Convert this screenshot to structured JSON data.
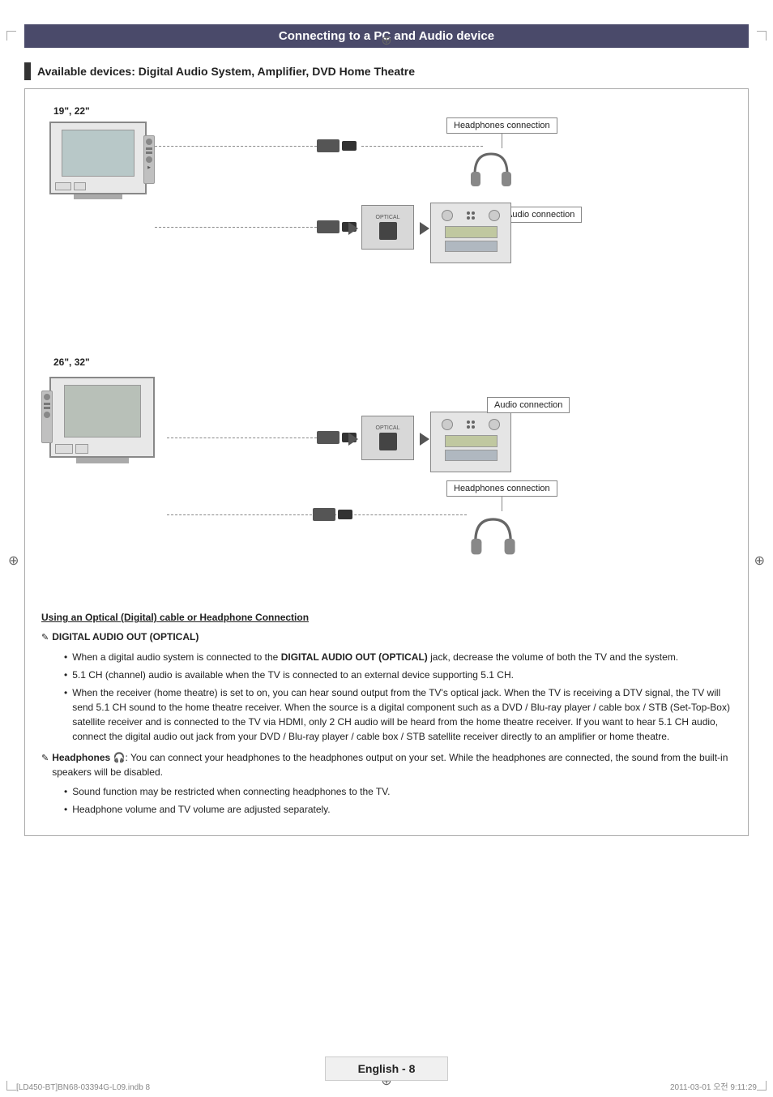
{
  "page": {
    "title": "Connecting to a PC and Audio device",
    "footer_label": "English - 8",
    "bottom_left": "[LD450-BT]BN68-03394G-L09.indb   8",
    "bottom_right": "2011-03-01   오전 9:11:29"
  },
  "section": {
    "heading": "Available devices: Digital Audio System, Amplifier, DVD Home Theatre"
  },
  "diagram": {
    "top_tv_label": "19\", 22\"",
    "bottom_tv_label": "26\", 32\"",
    "headphones_connection_1": "Headphones connection",
    "audio_connection_1": "Audio connection",
    "headphones_connection_2": "Headphones connection",
    "audio_connection_2": "Audio connection",
    "optical_label": "OPTICAL"
  },
  "notes": {
    "underline_title": "Using an Optical (Digital) cable or Headphone Connection",
    "digital_audio_heading": "DIGITAL AUDIO OUT (OPTICAL)",
    "bullets_digital": [
      "When a digital audio system is connected to the DIGITAL AUDIO OUT (OPTICAL) jack, decrease the volume of both the TV and the system.",
      "5.1 CH (channel) audio is available when the TV is connected to an external device supporting 5.1 CH.",
      "When the receiver (home theatre) is set to on, you can hear sound output from the TV's optical jack. When the TV is receiving a DTV signal, the TV will send 5.1 CH sound to the home theatre receiver. When the source is a digital component such as a DVD / Blu-ray player / cable box / STB (Set-Top-Box) satellite receiver and is connected to the TV via HDMI, only 2 CH audio will be heard from the home theatre receiver. If you want to hear 5.1 CH audio, connect the digital audio out jack from your DVD / Blu-ray player / cable box / STB satellite receiver directly to an amplifier or home theatre."
    ],
    "headphones_heading": "Headphones",
    "headphones_icon": "🎧",
    "headphones_text": ": You can connect your headphones to the headphones output on your set. While the headphones are connected, the sound from the built-in speakers will be disabled.",
    "bullets_headphones": [
      "Sound function may be restricted when connecting headphones to the TV.",
      "Headphone volume and TV volume are adjusted separately."
    ]
  }
}
